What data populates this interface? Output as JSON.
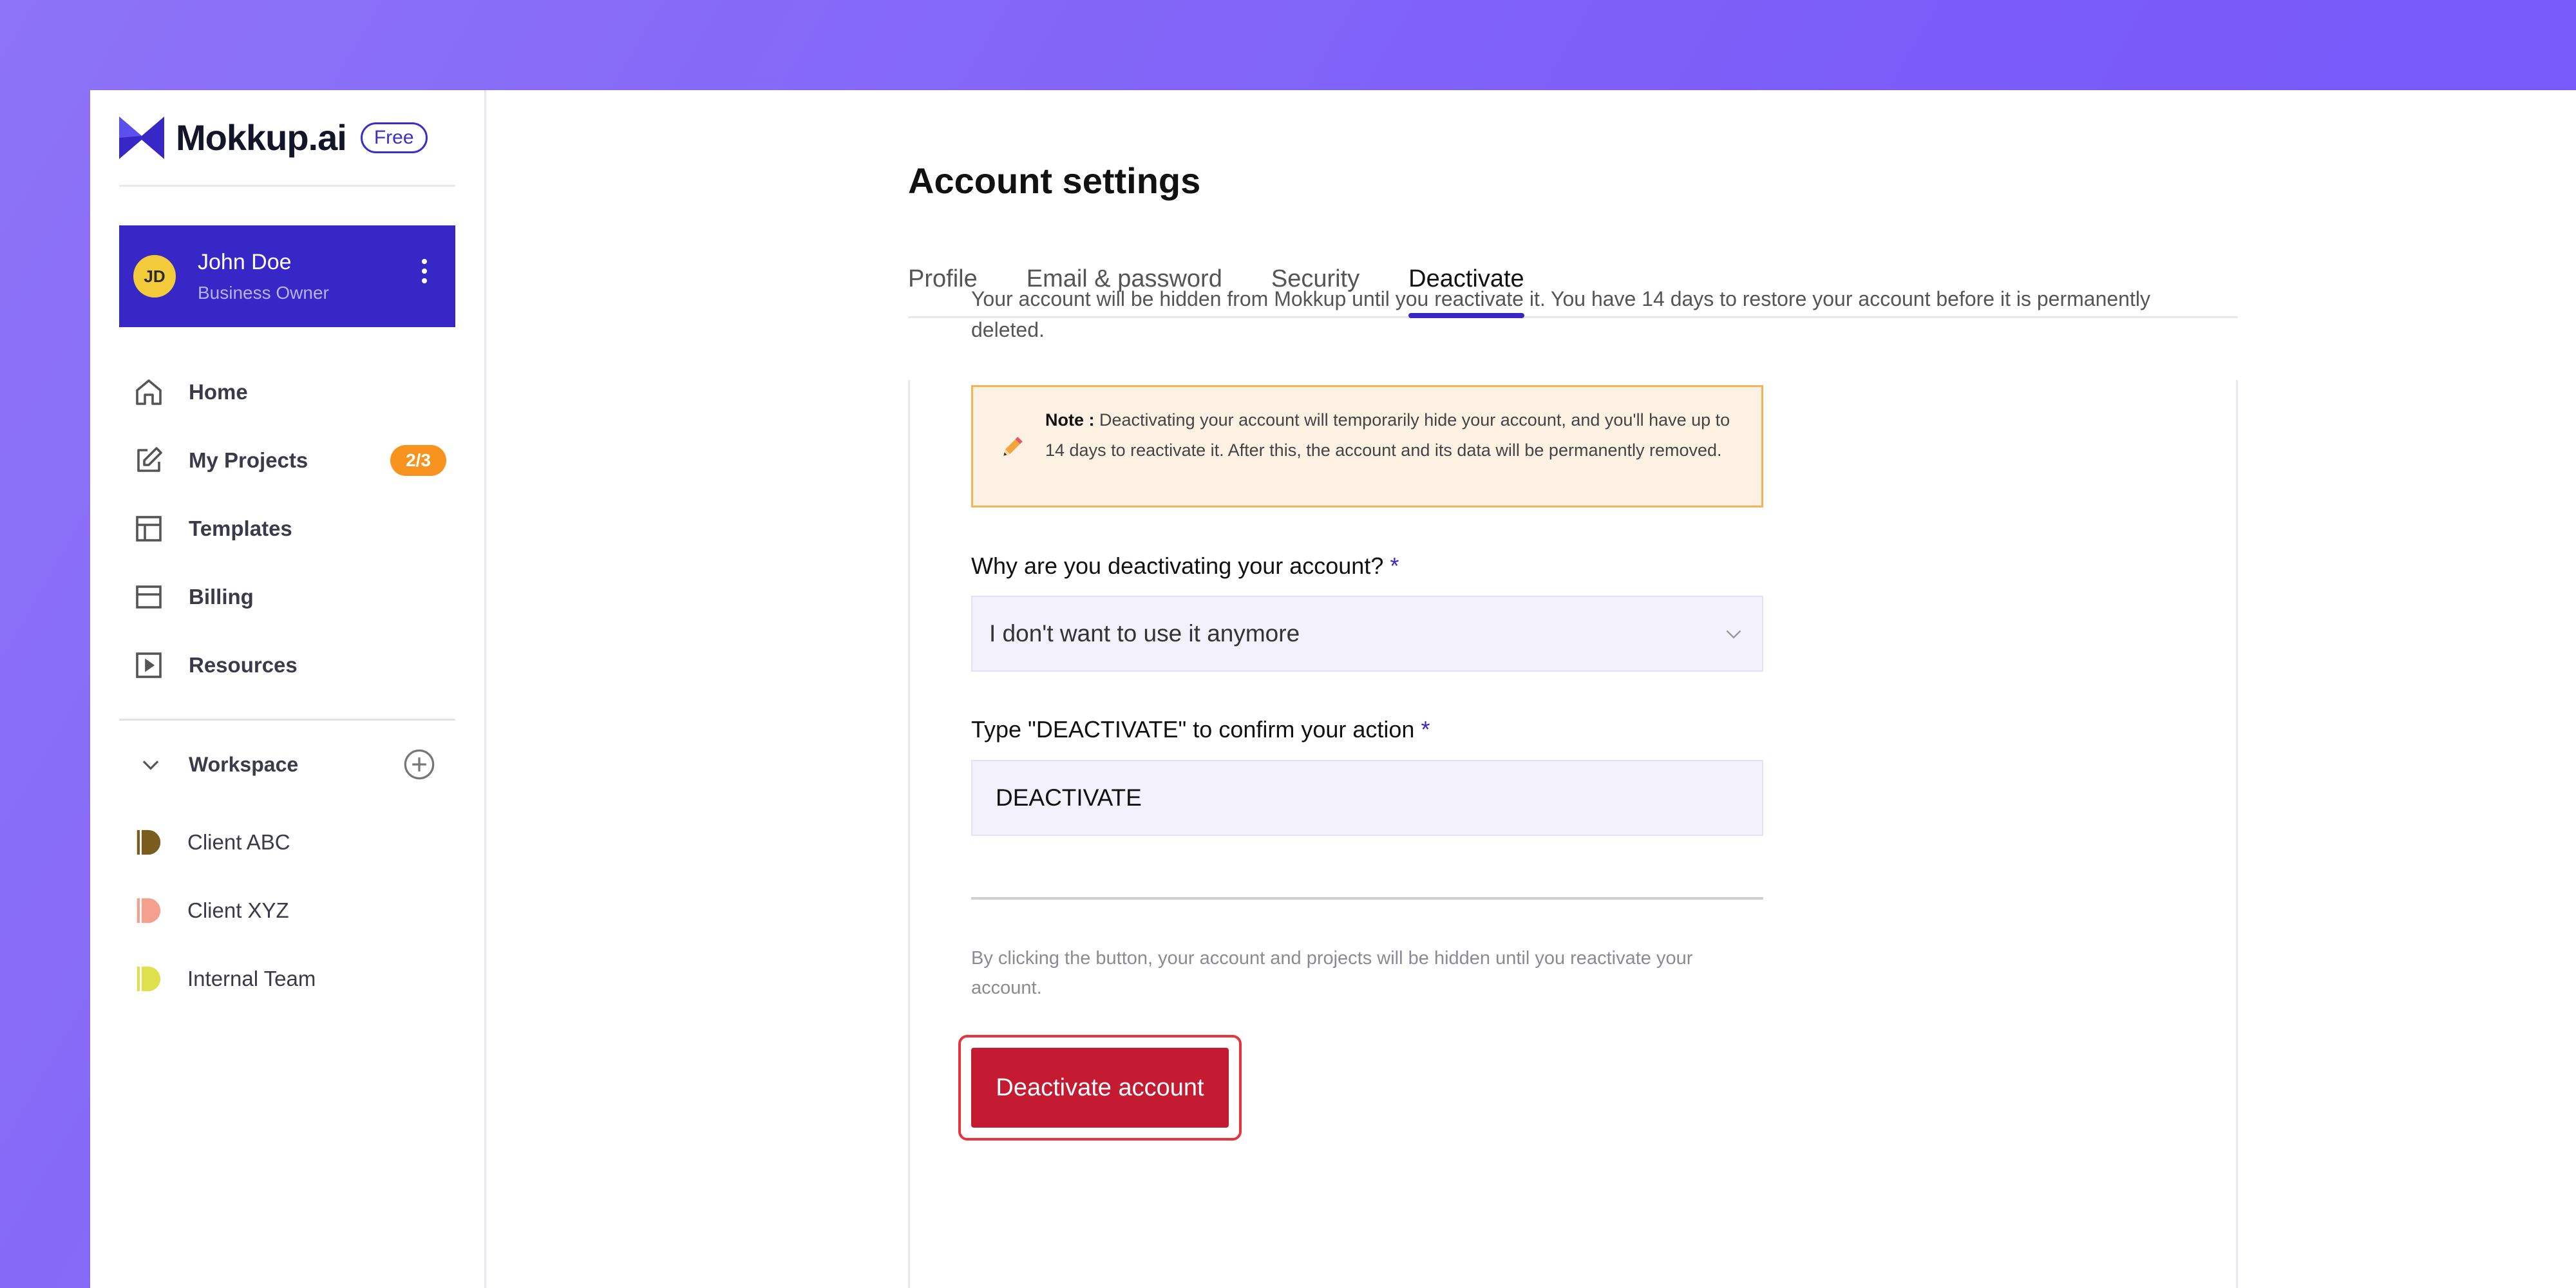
{
  "brand": {
    "name": "Mokkup.ai",
    "plan_badge": "Free"
  },
  "user": {
    "initials": "JD",
    "name": "John Doe",
    "role": "Business Owner"
  },
  "nav": [
    {
      "label": "Home",
      "icon": "home-icon"
    },
    {
      "label": "My Projects",
      "icon": "edit-icon",
      "badge": "2/3"
    },
    {
      "label": "Templates",
      "icon": "layout-icon"
    },
    {
      "label": "Billing",
      "icon": "card-icon"
    },
    {
      "label": "Resources",
      "icon": "play-square-icon"
    }
  ],
  "workspace": {
    "title": "Workspace",
    "items": [
      {
        "label": "Client ABC",
        "color": "#7a5c1e"
      },
      {
        "label": "Client XYZ",
        "color": "#f3a08f"
      },
      {
        "label": "Internal Team",
        "color": "#dfe04e"
      }
    ]
  },
  "page": {
    "title": "Account settings",
    "tabs": [
      "Profile",
      "Email & password",
      "Security",
      "Deactivate"
    ],
    "active_tab": "Deactivate"
  },
  "deactivate": {
    "intro": "Your account will be hidden from Mokkup until you reactivate it. You have 14 days to restore your account before it is permanently deleted.",
    "note_label": "Note :",
    "note_text": " Deactivating your account will temporarily hide your account, and you'll have up to 14 days to reactivate it. After this, the account and its data will be permanently removed.",
    "reason_label": "Why are you deactivating your account?",
    "reason_value": "I don't want to use it anymore",
    "confirm_label": "Type \"DEACTIVATE\" to confirm your action",
    "confirm_value": "DEACTIVATE",
    "required_mark": "*",
    "disclaimer": "By clicking the button, your account and projects will be hidden until you reactivate your account.",
    "button_label": "Deactivate account"
  },
  "colors": {
    "accent": "#3627c6",
    "badge": "#f7931e",
    "danger": "#c41a32",
    "note_bg": "#fdf1e4",
    "note_border": "#f6b257"
  }
}
